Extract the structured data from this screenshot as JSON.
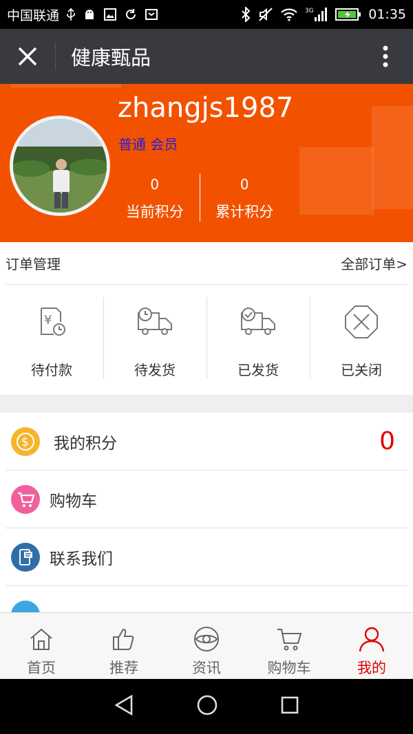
{
  "status_bar": {
    "carrier": "中国联通",
    "network": "3G",
    "time": "01:35"
  },
  "title_bar": {
    "title": "健康甄品",
    "close_icon": "close-icon",
    "more_icon": "more-vertical-icon"
  },
  "profile": {
    "username": "zhangjs1987",
    "level": "普通 会员",
    "current_points_value": "0",
    "current_points_label": "当前积分",
    "total_points_value": "0",
    "total_points_label": "累计积分",
    "bg_color": "#f25200"
  },
  "orders": {
    "title": "订单管理",
    "all_label": "全部订单>",
    "items": [
      {
        "label": "待付款",
        "icon": "pending-payment-icon"
      },
      {
        "label": "待发货",
        "icon": "truck-clock-icon"
      },
      {
        "label": "已发货",
        "icon": "truck-check-icon"
      },
      {
        "label": "已关闭",
        "icon": "closed-x-icon"
      }
    ]
  },
  "menu": {
    "items": [
      {
        "label": "我的积分",
        "value": "0",
        "icon": "coin-icon",
        "color": "#f5b52a"
      },
      {
        "label": "购物车",
        "icon": "cart-icon",
        "color": "#f0609c"
      },
      {
        "label": "联系我们",
        "icon": "contact-icon",
        "color": "#2f6ea8"
      },
      {
        "icon": "partial-icon",
        "color": "#3ba7e0"
      }
    ]
  },
  "tabbar": {
    "tabs": [
      {
        "label": "首页",
        "icon": "home-icon"
      },
      {
        "label": "推荐",
        "icon": "thumbs-up-icon"
      },
      {
        "label": "资讯",
        "icon": "eye-icon"
      },
      {
        "label": "购物车",
        "icon": "cart-icon"
      },
      {
        "label": "我的",
        "icon": "user-icon",
        "active": true
      }
    ],
    "active_color": "#e20000"
  }
}
